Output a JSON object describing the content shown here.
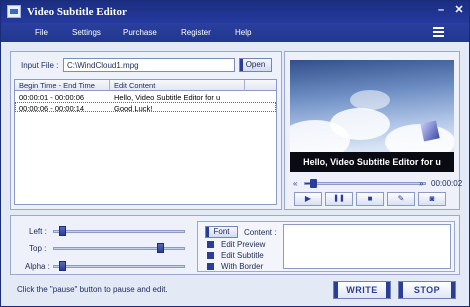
{
  "window": {
    "title": "Video Subtitle Editor",
    "minimize_symbol": "–",
    "close_symbol": "✕"
  },
  "menu": {
    "items": [
      "File",
      "Settings",
      "Purchase",
      "Register",
      "Help"
    ],
    "icon": "hamburger-menu-icon"
  },
  "input": {
    "label": "Input File :",
    "value": "C:\\WindCloud1.mpg",
    "open_label": "Open"
  },
  "table": {
    "columns": [
      "Begin Time - End Time",
      "Edit Content"
    ],
    "rows": [
      {
        "time": "00:00:01 - 00:00:06",
        "content": "Hello, Video Subtitle Editor for u"
      },
      {
        "time": "00:00:06 - 00:00:14",
        "content": "Good Luck!"
      }
    ]
  },
  "player": {
    "subtitle": "Hello, Video Subtitle Editor for u",
    "time": "00:00:02",
    "progress": 0.04,
    "rewind_icon": "«",
    "forward_icon": "»",
    "controls": [
      {
        "name": "play-button",
        "icon": "▶"
      },
      {
        "name": "pause-button",
        "icon": "❚❚"
      },
      {
        "name": "stop-button",
        "icon": "■"
      },
      {
        "name": "edit-button",
        "icon": "✎"
      },
      {
        "name": "snapshot-button",
        "icon": "◙"
      }
    ]
  },
  "position": {
    "left_label": "Left :",
    "top_label": "Top :",
    "alpha_label": "Alpha :",
    "left_value": 0.04,
    "top_value": 0.84,
    "alpha_value": 0.04
  },
  "font": {
    "font_button": "Font",
    "content_label": "Content :",
    "options": [
      "Edit Preview",
      "Edit Subtitle",
      "With Border"
    ]
  },
  "status": {
    "message": "Click the \"pause\" button to pause and edit.",
    "write_label": "WRITE",
    "stop_label": "STOP"
  },
  "colors": {
    "accent": "#2a3e99",
    "titlebar": "#1b2e83",
    "background": "#e4e9f6"
  }
}
